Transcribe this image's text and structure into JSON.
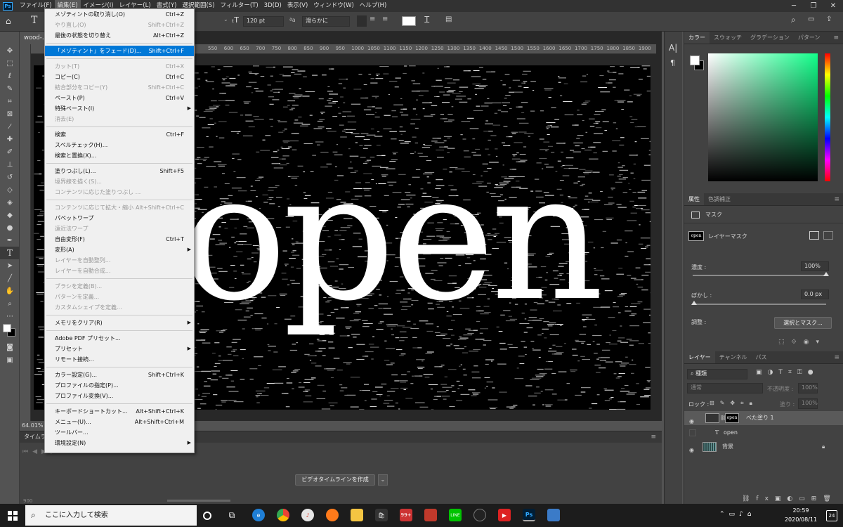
{
  "app": {
    "logo": "Ps"
  },
  "menubar": {
    "items": [
      "ファイル(F)",
      "編集(E)",
      "イメージ(I)",
      "レイヤー(L)",
      "書式(Y)",
      "選択範囲(S)",
      "フィルター(T)",
      "3D(D)",
      "表示(V)",
      "ウィンドウ(W)",
      "ヘルプ(H)"
    ],
    "active_index": 1
  },
  "options_bar": {
    "font_size": "120 pt",
    "antialias_prefix": "ªa",
    "antialias": "滑らかに"
  },
  "document": {
    "tab": "wood-…",
    "zoom": "64.01%",
    "canvas_text": "open"
  },
  "ruler": {
    "ticks": [
      "550",
      "600",
      "650",
      "700",
      "750",
      "800",
      "850",
      "900",
      "950",
      "1000",
      "1050",
      "1100",
      "1150",
      "1200",
      "1250",
      "1300",
      "1350",
      "1400",
      "1450",
      "1500",
      "1550",
      "1600",
      "1650",
      "1700",
      "1750",
      "1800",
      "1850",
      "1900"
    ]
  },
  "timeline": {
    "tab": "タイムライ",
    "create_button": "ビデオタイムラインを作成",
    "frame_label": "900"
  },
  "edit_menu": {
    "groups": [
      [
        {
          "label": "メゾティントの取り消し(O)",
          "shortcut": "Ctrl+Z",
          "disabled": false
        },
        {
          "label": "やり直し(O)",
          "shortcut": "Shift+Ctrl+Z",
          "disabled": true
        },
        {
          "label": "最後の状態を切り替え",
          "shortcut": "Alt+Ctrl+Z",
          "disabled": false
        }
      ],
      [
        {
          "label": "「メゾティント」をフェード(D)...",
          "shortcut": "Shift+Ctrl+F",
          "disabled": false,
          "highlighted": true
        }
      ],
      [
        {
          "label": "カット(T)",
          "shortcut": "Ctrl+X",
          "disabled": true
        },
        {
          "label": "コピー(C)",
          "shortcut": "Ctrl+C",
          "disabled": false
        },
        {
          "label": "結合部分をコピー(Y)",
          "shortcut": "Shift+Ctrl+C",
          "disabled": true
        },
        {
          "label": "ペースト(P)",
          "shortcut": "Ctrl+V",
          "disabled": false
        },
        {
          "label": "特殊ペースト(I)",
          "shortcut": "",
          "disabled": false,
          "submenu": true
        },
        {
          "label": "消去(E)",
          "shortcut": "",
          "disabled": true
        }
      ],
      [
        {
          "label": "検索",
          "shortcut": "Ctrl+F",
          "disabled": false
        },
        {
          "label": "スペルチェック(H)...",
          "shortcut": "",
          "disabled": false
        },
        {
          "label": "検索と置換(X)...",
          "shortcut": "",
          "disabled": false
        }
      ],
      [
        {
          "label": "塗りつぶし(L)...",
          "shortcut": "Shift+F5",
          "disabled": false
        },
        {
          "label": "境界線を描く(S)...",
          "shortcut": "",
          "disabled": true
        },
        {
          "label": "コンテンツに応じた塗りつぶし ...",
          "shortcut": "",
          "disabled": true
        }
      ],
      [
        {
          "label": "コンテンツに応じて拡大・縮小",
          "shortcut": "Alt+Shift+Ctrl+C",
          "disabled": true
        },
        {
          "label": "パペットワープ",
          "shortcut": "",
          "disabled": false
        },
        {
          "label": "遠近法ワープ",
          "shortcut": "",
          "disabled": true
        },
        {
          "label": "自由変形(F)",
          "shortcut": "Ctrl+T",
          "disabled": false
        },
        {
          "label": "変形(A)",
          "shortcut": "",
          "disabled": false,
          "submenu": true
        },
        {
          "label": "レイヤーを自動整列...",
          "shortcut": "",
          "disabled": true
        },
        {
          "label": "レイヤーを自動合成...",
          "shortcut": "",
          "disabled": true
        }
      ],
      [
        {
          "label": "ブラシを定義(B)...",
          "shortcut": "",
          "disabled": true
        },
        {
          "label": "パターンを定義...",
          "shortcut": "",
          "disabled": true
        },
        {
          "label": "カスタムシェイプを定義...",
          "shortcut": "",
          "disabled": true
        }
      ],
      [
        {
          "label": "メモリをクリア(R)",
          "shortcut": "",
          "disabled": false,
          "submenu": true
        }
      ],
      [
        {
          "label": "Adobe PDF プリセット...",
          "shortcut": "",
          "disabled": false
        },
        {
          "label": "プリセット",
          "shortcut": "",
          "disabled": false,
          "submenu": true
        },
        {
          "label": "リモート接続...",
          "shortcut": "",
          "disabled": false
        }
      ],
      [
        {
          "label": "カラー設定(G)...",
          "shortcut": "Shift+Ctrl+K",
          "disabled": false
        },
        {
          "label": "プロファイルの指定(P)...",
          "shortcut": "",
          "disabled": false
        },
        {
          "label": "プロファイル変換(V)...",
          "shortcut": "",
          "disabled": false
        }
      ],
      [
        {
          "label": "キーボードショートカット...",
          "shortcut": "Alt+Shift+Ctrl+K",
          "disabled": false
        },
        {
          "label": "メニュー(U)...",
          "shortcut": "Alt+Shift+Ctrl+M",
          "disabled": false
        },
        {
          "label": "ツールバー...",
          "shortcut": "",
          "disabled": false
        },
        {
          "label": "環境設定(N)",
          "shortcut": "",
          "disabled": false,
          "submenu": true
        }
      ]
    ]
  },
  "color_panel": {
    "tabs": [
      "カラー",
      "スウォッチ",
      "グラデーション",
      "パターン"
    ],
    "active_index": 0
  },
  "properties_panel": {
    "tabs": [
      "属性",
      "色調補正"
    ],
    "active_index": 0,
    "section": "マスク",
    "mask_label": "レイヤーマスク",
    "thumb_text": "open",
    "density_label": "濃度 :",
    "density_value": "100%",
    "feather_label": "ぼかし :",
    "feather_value": "0.0 px",
    "refine_label": "調整 :",
    "select_mask_button": "選択とマスク..."
  },
  "layers_panel": {
    "tabs": [
      "レイヤー",
      "チャンネル",
      "パス"
    ],
    "active_index": 0,
    "filter_label": "種類",
    "blend_mode": "通常",
    "opacity_label": "不透明度 :",
    "opacity_value": "100%",
    "lock_label": "ロック :",
    "fill_label": "塗り :",
    "fill_value": "100%",
    "layers": [
      {
        "name": "べた塗り 1",
        "kind": "fill",
        "selected": true,
        "visible": true,
        "mask_text": "open"
      },
      {
        "name": "open",
        "kind": "text",
        "selected": false,
        "visible": false
      },
      {
        "name": "背景",
        "kind": "image",
        "selected": false,
        "visible": true,
        "locked": true
      }
    ]
  },
  "taskbar": {
    "search_placeholder": "ここに入力して検索",
    "badge": "99+",
    "time": "20:59",
    "date": "2020/08/11",
    "notification_count": "24",
    "ps_label": "Ps"
  },
  "colors": {
    "accent": "#0078d7",
    "panel": "#424242",
    "app_bg": "#535353",
    "menu_bg": "#f0f0f0"
  }
}
